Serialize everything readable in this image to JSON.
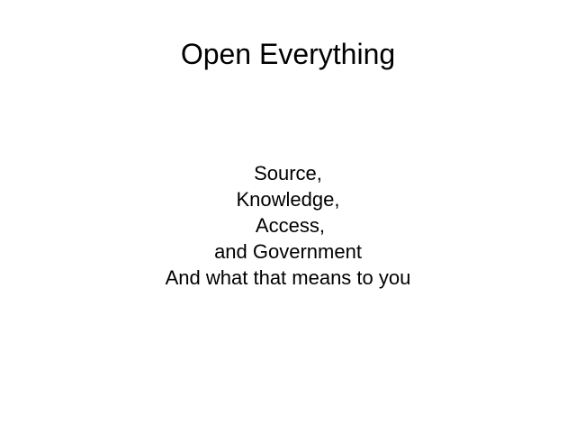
{
  "slide": {
    "title": "Open Everything",
    "body_lines": [
      "Source,",
      "Knowledge,",
      " Access,",
      "and Government",
      "And what that means to you"
    ]
  }
}
